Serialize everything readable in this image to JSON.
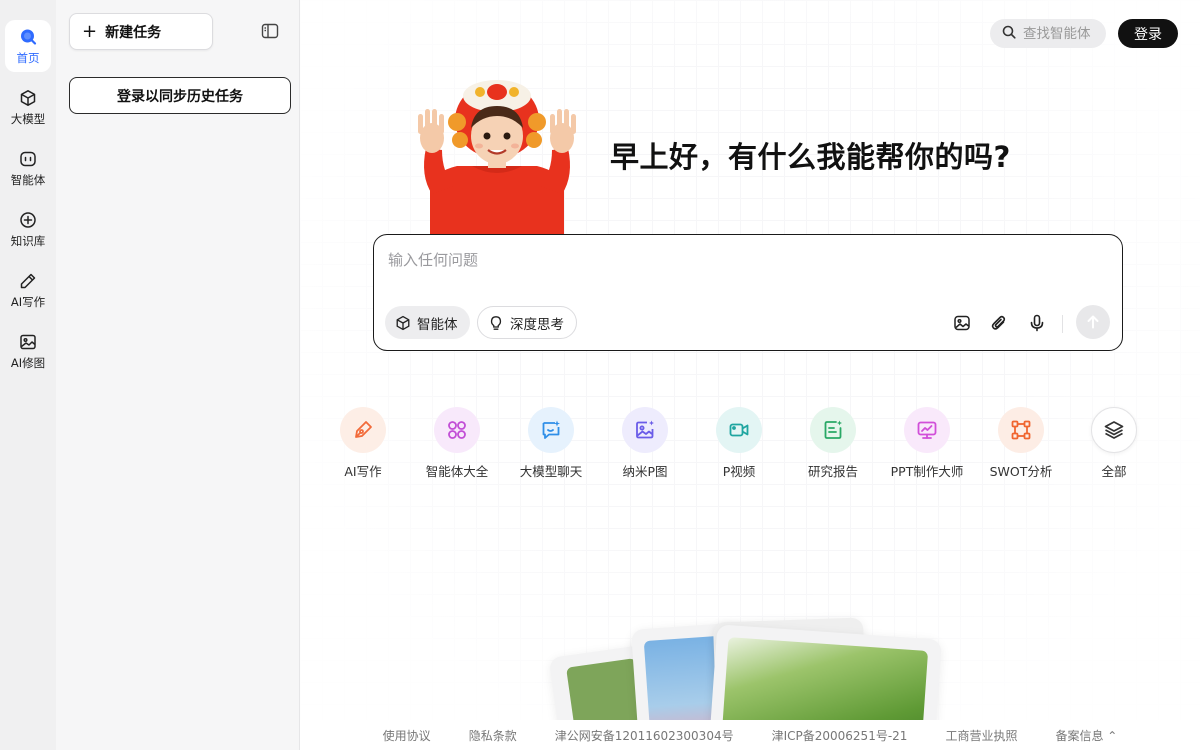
{
  "sidebar": {
    "items": [
      {
        "label": "首页",
        "icon": "home-search-icon",
        "active": true
      },
      {
        "label": "大模型",
        "icon": "cube-icon",
        "active": false
      },
      {
        "label": "智能体",
        "icon": "agent-icon",
        "active": false
      },
      {
        "label": "知识库",
        "icon": "knowledge-icon",
        "active": false
      },
      {
        "label": "AI写作",
        "icon": "pencil-icon",
        "active": false
      },
      {
        "label": "AI修图",
        "icon": "image-icon",
        "active": false
      }
    ]
  },
  "panel": {
    "new_task_label": "新建任务",
    "login_sync_label": "登录以同步历史任务"
  },
  "header": {
    "search_placeholder": "查找智能体",
    "login_label": "登录"
  },
  "main": {
    "greeting": "早上好，有什么我能帮你的吗?",
    "composer": {
      "placeholder": "输入任何问题",
      "chips": [
        "智能体",
        "深度思考"
      ]
    },
    "shortcuts": [
      {
        "label": "AI写作",
        "icon": "pen-nib-icon",
        "color": "#f26b3a",
        "bg": "#fdeee6"
      },
      {
        "label": "智能体大全",
        "icon": "grid-circles-icon",
        "color": "#c24fd6",
        "bg": "#f8e9fb"
      },
      {
        "label": "大模型聊天",
        "icon": "chat-sparkle-icon",
        "color": "#2f8fe8",
        "bg": "#e6f2fd"
      },
      {
        "label": "纳米P图",
        "icon": "photo-sparkle-icon",
        "color": "#6a5ce8",
        "bg": "#eeecfd"
      },
      {
        "label": "P视频",
        "icon": "video-icon",
        "color": "#1fa5a0",
        "bg": "#e3f5f4"
      },
      {
        "label": "研究报告",
        "icon": "report-icon",
        "color": "#29a866",
        "bg": "#e5f6ec"
      },
      {
        "label": "PPT制作大师",
        "icon": "presentation-icon",
        "color": "#d14fd9",
        "bg": "#f9e9fb"
      },
      {
        "label": "SWOT分析",
        "icon": "nodes-icon",
        "color": "#f0652f",
        "bg": "#fdede5"
      },
      {
        "label": "全部",
        "icon": "layers-icon",
        "color": "#333333",
        "bg": "#ffffff"
      }
    ]
  },
  "footer": {
    "links": [
      "使用协议",
      "隐私条款",
      "津公网安备12011602300304号",
      "津ICP备20006251号-21",
      "工商营业执照",
      "备案信息 ⌃"
    ]
  },
  "colors": {
    "accent": "#2f6bff",
    "primary_button": "#111111"
  }
}
